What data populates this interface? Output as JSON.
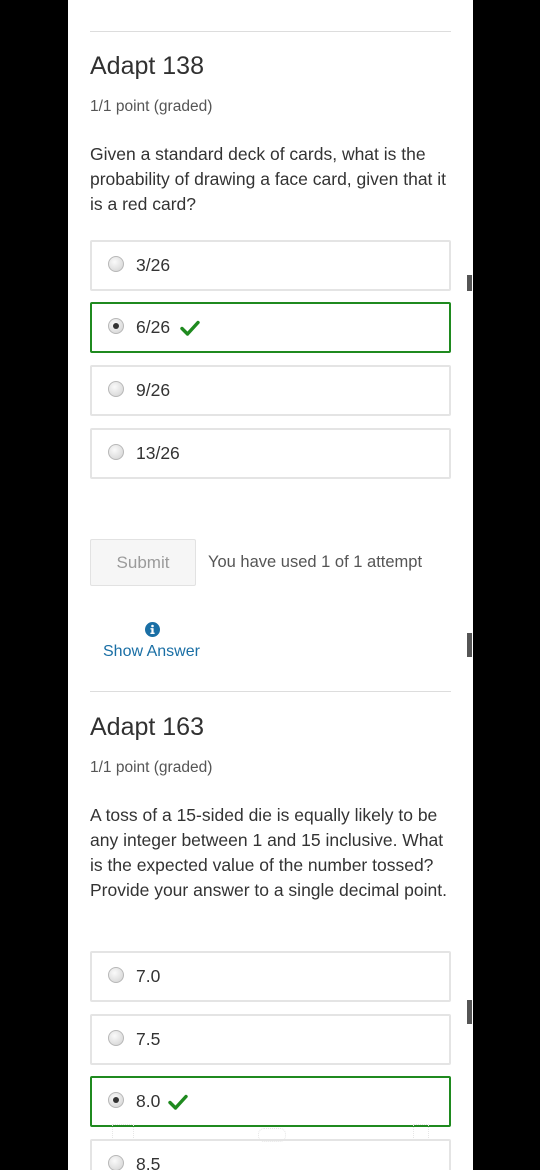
{
  "problems": [
    {
      "title": "Adapt 138",
      "points": "1/1 point (graded)",
      "question": "Given a standard deck of cards, what is the probability of drawing a face card, given that it is a red card?",
      "choices": [
        {
          "label": "3/26",
          "selected": false,
          "correct": false
        },
        {
          "label": "6/26",
          "selected": true,
          "correct": true
        },
        {
          "label": "9/26",
          "selected": false,
          "correct": false
        },
        {
          "label": "13/26",
          "selected": false,
          "correct": false
        }
      ],
      "submit_label": "Submit",
      "attempts_text": "You have used 1 of 1 attempt",
      "show_answer_label": "Show Answer"
    },
    {
      "title": "Adapt 163",
      "points": "1/1 point (graded)",
      "question": "A toss of a 15-sided die is equally likely to be any integer between 1 and 15 inclusive. What is the expected value of the number tossed? Provide your answer to a single decimal point.",
      "choices": [
        {
          "label": "7.0",
          "selected": false,
          "correct": false
        },
        {
          "label": "7.5",
          "selected": false,
          "correct": false
        },
        {
          "label": "8.0",
          "selected": true,
          "correct": true
        },
        {
          "label": "8.5",
          "selected": false,
          "correct": false
        }
      ]
    }
  ],
  "icons": {
    "correct": "checkmark-icon",
    "info": "info-icon"
  },
  "colors": {
    "correct": "#1f8a1f",
    "link": "#1a6fa5",
    "background": "#000000",
    "page": "#ffffff"
  }
}
